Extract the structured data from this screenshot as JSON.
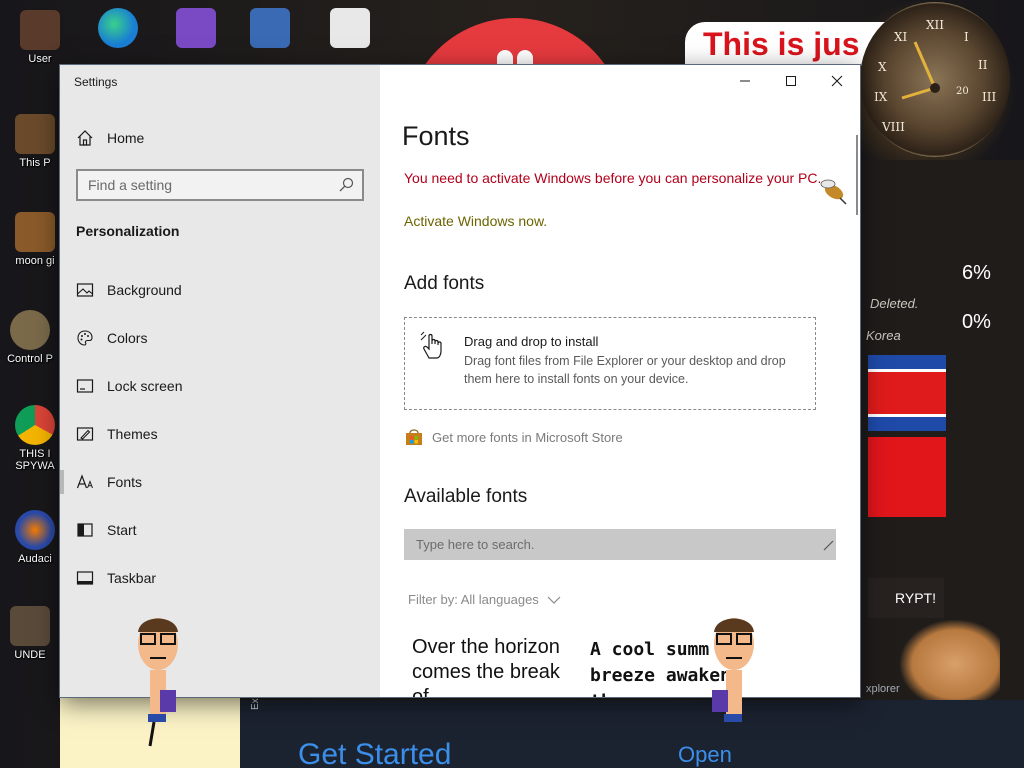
{
  "desktop": {
    "icons": [
      {
        "label": "User",
        "color": "#5a3a2a"
      },
      {
        "label": "This P",
        "color": "#6a4a2a"
      },
      {
        "label": "moon gi",
        "color": "#8a5a2a"
      },
      {
        "label": "Control P",
        "color": "#7a6a4a"
      },
      {
        "label": "THIS I",
        "color": "#2f8f3f"
      },
      {
        "label": "SPYWA",
        "color": "#2f8f3f"
      },
      {
        "label": "Audaci",
        "color": "#2a4aa8"
      },
      {
        "label": "UNDE",
        "color": "#5a4a3a"
      }
    ],
    "top_icons": [
      {
        "label": "",
        "color": "#1a7fd4"
      },
      {
        "label": "",
        "color": "#7a4ac4"
      },
      {
        "label": "",
        "color": "#3a6ab4"
      },
      {
        "label": "",
        "color": "#e8e8e8"
      }
    ],
    "banner_text": "This is jus",
    "clock_numerals": [
      "XII",
      "I",
      "II",
      "III",
      "XI",
      "X",
      "IX",
      "VIII"
    ],
    "clock_subdial": "20",
    "right_panel": {
      "deleted_text": "Deleted.",
      "korea_text": "Korea",
      "percent1": "6%",
      "percent2": "0%",
      "crypt_label": "RYPT!",
      "explorer_label": "xplorer"
    },
    "get_started": "Get Started",
    "open_label": "Open",
    "explorer_side_label": "Explorer",
    "colors": {
      "accent_red": "#e53a3e",
      "link_blue": "#3b8eea"
    }
  },
  "window": {
    "title": "Settings",
    "controls": {
      "minimize": "minimize-icon",
      "maximize": "maximize-icon",
      "close": "close-icon"
    }
  },
  "sidebar": {
    "home_label": "Home",
    "search_placeholder": "Find a setting",
    "section_title": "Personalization",
    "items": [
      {
        "label": "Background",
        "icon": "picture-icon"
      },
      {
        "label": "Colors",
        "icon": "palette-icon"
      },
      {
        "label": "Lock screen",
        "icon": "lock-screen-icon"
      },
      {
        "label": "Themes",
        "icon": "themes-brush-icon"
      },
      {
        "label": "Fonts",
        "icon": "fonts-icon",
        "active": true
      },
      {
        "label": "Start",
        "icon": "start-icon"
      },
      {
        "label": "Taskbar",
        "icon": "taskbar-icon"
      }
    ]
  },
  "content": {
    "title": "Fonts",
    "warning": "You need to activate Windows before you can personalize your PC.",
    "activate_link": "Activate Windows now.",
    "add_fonts_heading": "Add fonts",
    "dropzone": {
      "title": "Drag and drop to install",
      "description": "Drag font files from File Explorer or your desktop and drop them here to install fonts on your device."
    },
    "store_link": "Get more fonts in Microsoft Store",
    "available_heading": "Available fonts",
    "font_search_placeholder": "Type here to search.",
    "filter_label": "Filter by: All languages",
    "previews": [
      "Over the horizon comes the break of",
      "A cool summ breeze awakens the"
    ]
  }
}
